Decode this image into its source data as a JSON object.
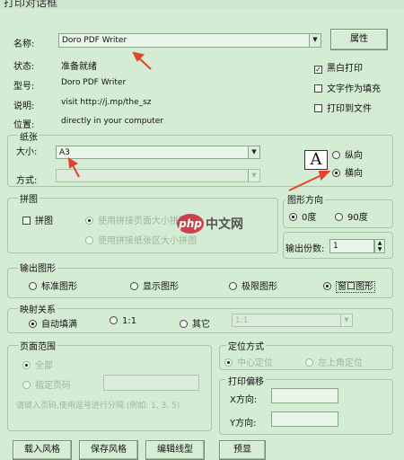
{
  "window": {
    "title": "打印对话框"
  },
  "printer": {
    "name_label": "名称:",
    "name_value": "Doro PDF Writer",
    "properties_button": "属性",
    "status_label": "状态:",
    "status_value": "准备就绪",
    "type_label": "型号:",
    "type_value": "Doro PDF Writer",
    "comment_label": "说明:",
    "comment_value": "visit http://j.mp/the_sz",
    "location_label": "位置:",
    "location_value": "directly in your computer",
    "bw_print": "黑白打印",
    "text_as_fill": "文字作为填充",
    "print_to_file": "打印到文件"
  },
  "paper": {
    "group_title": "纸张",
    "size_label": "大小:",
    "size_value": "A3",
    "source_label": "方式:",
    "source_value": "",
    "orientation_portrait": "纵向",
    "orientation_landscape": "横向",
    "orientation_icon_letter": "A"
  },
  "tile": {
    "group_title": "拼图",
    "checkbox_label": "拼图",
    "option_page_size": "使用拼接页面大小拼图",
    "option_paper_size": "使用拼接纸张区大小拼图"
  },
  "graphic_direction": {
    "group_title": "图形方向",
    "option_0": "0度",
    "option_90": "90度"
  },
  "copies": {
    "label": "输出份数:",
    "value": "1"
  },
  "output": {
    "group_title": "输出图形",
    "options": [
      "标准图形",
      "显示图形",
      "极限图形",
      "窗口图形"
    ],
    "selected": "窗口图形"
  },
  "mapping": {
    "group_title": "映射关系",
    "option_auto": "自动填满",
    "option_11": "1:1",
    "option_other": "其它",
    "ratio_value": "1:1"
  },
  "page_range": {
    "group_title": "页面范围",
    "option_all": "全部",
    "option_pages": "指定页码",
    "hint": "请键入页码,使用逗号进行分隔 (例如: 1, 3, 5)"
  },
  "anchor": {
    "group_title": "定位方式",
    "option_center": "中心定位",
    "option_topleft": "左上角定位"
  },
  "offset": {
    "group_title": "打印偏移",
    "x_label": "X方向:",
    "y_label": "Y方向:"
  },
  "bottom_buttons": [
    "载入风格",
    "保存风格",
    "编辑线型",
    "预显"
  ],
  "watermark": {
    "logo_text": "php",
    "site_text": "中文网"
  },
  "colors": {
    "background": "#d5ecd4",
    "arrow": "#e0442c"
  }
}
